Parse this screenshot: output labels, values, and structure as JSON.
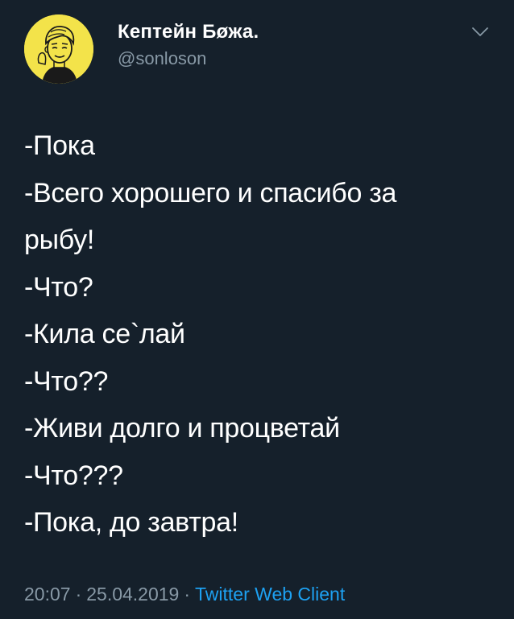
{
  "author": {
    "display_name": "Кептейн Бøжа.",
    "handle": "@sonloson",
    "avatar_icon": "cartoon-avatar",
    "avatar_bg": "#f3e34a"
  },
  "menu": {
    "icon": "chevron-down-icon"
  },
  "tweet": {
    "lines": [
      "-Пока",
      "-Всего хорошего и спасибо за",
      "рыбу!",
      "-Что?",
      "-Кила се`лай",
      "-Что??",
      "-Живи долго и процветай",
      "-Что???",
      "-Пока, до завтра!"
    ]
  },
  "meta": {
    "time": "20:07",
    "separator": "·",
    "date": "25.04.2019",
    "client": "Twitter Web Client"
  },
  "colors": {
    "background": "#15202b",
    "text": "#ffffff",
    "secondary": "#8899a6",
    "link": "#1da1f2"
  }
}
